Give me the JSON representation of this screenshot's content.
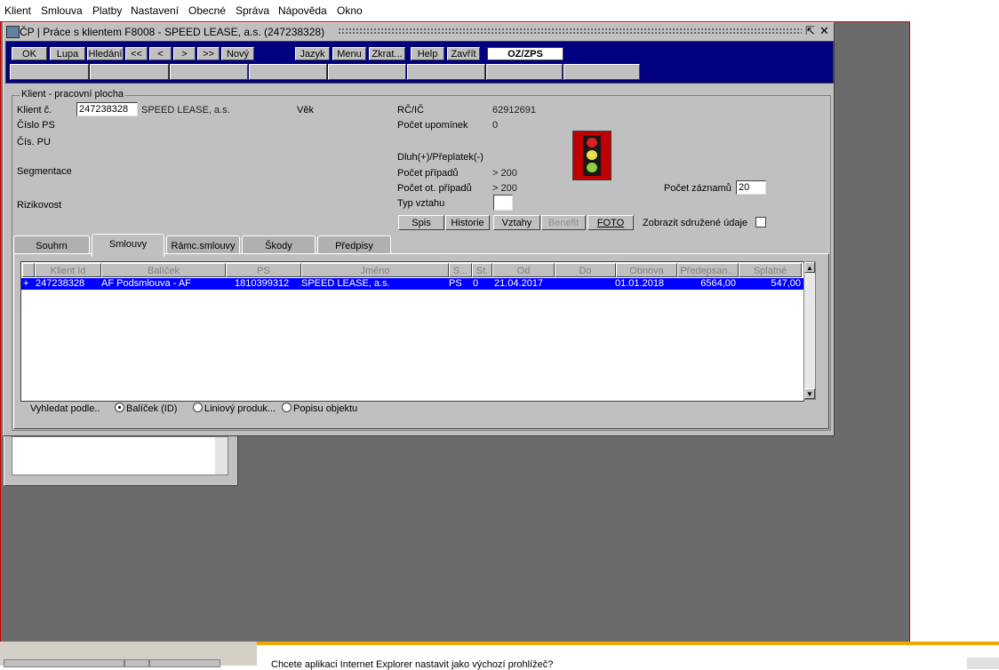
{
  "menubar": {
    "items": [
      "Klient",
      "Smlouva",
      "Platby",
      "Nastavení",
      "Obecné",
      "Správa",
      "Nápověda",
      "Okno"
    ]
  },
  "window": {
    "title": "ČP | Práce s klientem F8008 - SPEED LEASE, a.s. (247238328)"
  },
  "toolbar": {
    "ok": "OK",
    "lupa": "Lupa",
    "hledani": "Hledání",
    "first": "<<",
    "prev": "<",
    "next": ">",
    "last": ">>",
    "novy": "Nový",
    "jazyk": "Jazyk",
    "menu": "Menu",
    "zkrat": "Zkrat...",
    "help": "Help",
    "zavrit": "Zavřít",
    "oz": "OZ/ZPS"
  },
  "client": {
    "group_label": "Klient - pracovní plocha",
    "klient_c_label": "Klient č.",
    "klient_c_value": "247238328",
    "name": "SPEED LEASE, a.s.",
    "vek_label": "Věk",
    "cislo_ps_label": "Číslo PS",
    "cis_pu_label": "Čís. PU",
    "segmentace_label": "Segmentace",
    "rizikovost_label": "Rizikovost",
    "rc_label": "RČ/IČ",
    "rc_value": "62912691",
    "upominek_label": "Počet upomínek",
    "upominek_value": "0",
    "dluh_label": "Dluh(+)/Přeplatek(-)",
    "pripadu_label": "Počet případů",
    "pripadu_value": "> 200",
    "ot_pripadu_label": "Počet ot. případů",
    "ot_pripadu_value": "> 200",
    "typ_vztahu_label": "Typ vztahu",
    "zaznamu_label": "Počet záznamů",
    "zaznamu_value": "20"
  },
  "actions": {
    "spis": "Spis",
    "historie": "Historie",
    "vztahy": "Vztahy",
    "benefit": "Benefit",
    "foto": "FOTO",
    "sdruzene_label": "Zobrazit sdružené údaje"
  },
  "tabs": [
    "Souhrn",
    "Smlouvy",
    "Rámc.smlouvy",
    "Škody",
    "Předpisy"
  ],
  "grid": {
    "headers": [
      "Klient Id",
      "Balíček",
      "PS",
      "Jméno",
      "S...",
      "St.",
      "Od",
      "Do",
      "Obnova",
      "Předepsan...",
      "Splatné"
    ],
    "rows": [
      {
        "marker": "+",
        "klient_id": "247238328",
        "balicek": "AF Podsmlouva - AF",
        "ps": "1810399312",
        "jmeno": "SPEED LEASE, a.s.",
        "s": "PS",
        "st": "0",
        "od": "21.04.2017",
        "do": "",
        "obnova": "01.01.2018",
        "predepsano": "6564,00",
        "splatne": "547,00"
      }
    ]
  },
  "search": {
    "label": "Vyhledat podle..",
    "options": [
      "Balíček (ID)",
      "Liniový produk...",
      "Popisu objektu"
    ],
    "selected": "Balíček (ID)"
  },
  "ie_bar": {
    "text": "Chcete aplikaci Internet Explorer nastavit jako výchozí prohlížeč?"
  },
  "colors": {
    "desktop": "#6b6b6b",
    "toolbar": "#000080",
    "selected_row": "#0000ff",
    "frame_border": "#d00000"
  }
}
